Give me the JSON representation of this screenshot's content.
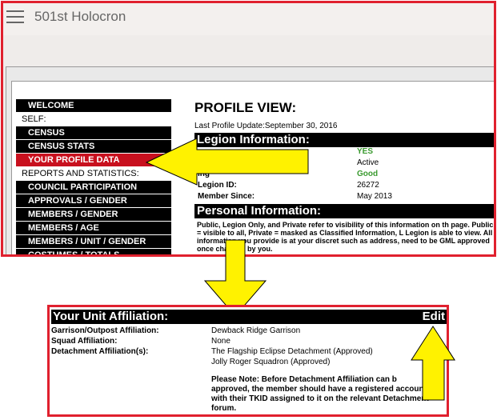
{
  "app": {
    "title": "501st Holocron"
  },
  "menu": {
    "items": [
      {
        "label": "WELCOME",
        "kind": "item"
      },
      {
        "label": "SELF:",
        "kind": "section"
      },
      {
        "label": "CENSUS",
        "kind": "item"
      },
      {
        "label": "CENSUS STATS",
        "kind": "item"
      },
      {
        "label": "YOUR PROFILE DATA",
        "kind": "active"
      },
      {
        "label": "REPORTS AND STATISTICS:",
        "kind": "section"
      },
      {
        "label": "COUNCIL PARTICIPATION",
        "kind": "item"
      },
      {
        "label": "APPROVALS / GENDER",
        "kind": "item"
      },
      {
        "label": "MEMBERS / GENDER",
        "kind": "item"
      },
      {
        "label": "MEMBERS / AGE",
        "kind": "item"
      },
      {
        "label": "MEMBERS / UNIT / GENDER",
        "kind": "item"
      },
      {
        "label": "COSTUMES / TOTALS",
        "kind": "item"
      }
    ]
  },
  "profile": {
    "title": "PROFILE VIEW:",
    "last_update": "Last Profile Update:September 30, 2016",
    "legion_header": "Legion Information:",
    "rows": [
      {
        "label": "",
        "value": "YES",
        "style": "green"
      },
      {
        "label": "",
        "value": "Active",
        "style": ""
      },
      {
        "label": "ing",
        "value": "Good",
        "style": "green"
      },
      {
        "label": "Legion ID:",
        "value": "26272",
        "style": ""
      },
      {
        "label": "Member Since:",
        "value": "May 2013",
        "style": ""
      }
    ],
    "personal_header": "Personal Information:",
    "personal_text": "Public, Legion Only, and Private refer to visibility of this information on th page. Public = visible to all, Private = masked as Classified Information, L Legion is able to view. All information you provide is at your discret such as address, need to be GML approved once changed by you."
  },
  "unit": {
    "title": "Your Unit Affiliation:",
    "edit_label": "Edit",
    "rows": [
      {
        "label": "Garrison/Outpost Affiliation:",
        "value": "Dewback Ridge Garrison"
      },
      {
        "label": "Squad Affiliation:",
        "value": "None"
      },
      {
        "label": "Detachment Affiliation(s):",
        "value": "The Flagship Eclipse Detachment (Approved)"
      },
      {
        "label": "",
        "value": "Jolly Roger Squadron (Approved)"
      }
    ],
    "note": "Please Note: Before Detachment Affiliation can b approved, the member should have a registered account with their TKID assigned to it on the relevant Detachment forum."
  },
  "colors": {
    "frame_red": "#e0202e",
    "arrow_yellow": "#fff200",
    "active_menu": "#c8101e",
    "green_text": "#3a9a2f"
  }
}
